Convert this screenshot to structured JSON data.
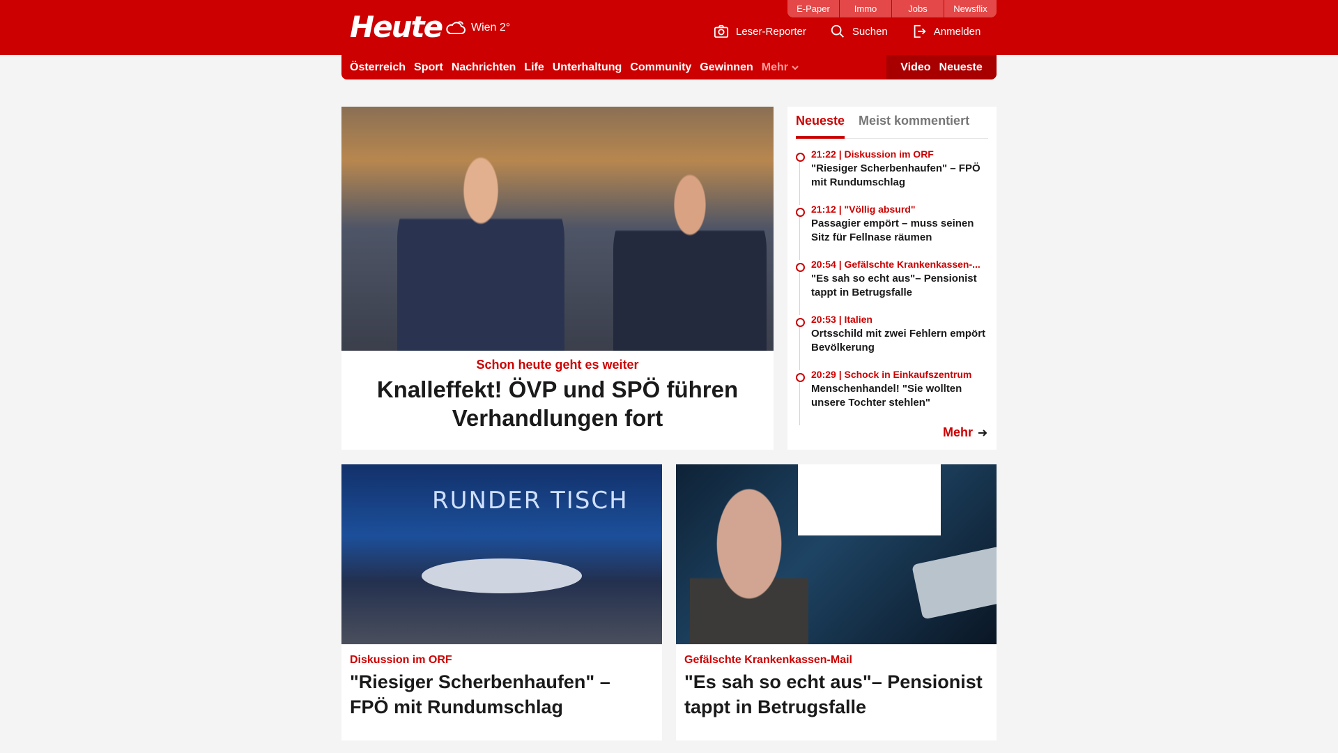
{
  "brand": {
    "logo": "Heute",
    "weather": "Wien 2°"
  },
  "quicklinks": [
    "E-Paper",
    "Immo",
    "Jobs",
    "Newsflix"
  ],
  "actions": {
    "reporter": "Leser-Reporter",
    "search": "Suchen",
    "login": "Anmelden"
  },
  "nav": {
    "items": [
      "Österreich",
      "Sport",
      "Nachrichten",
      "Life",
      "Unterhaltung",
      "Community",
      "Gewinnen"
    ],
    "more": "Mehr",
    "video": "Video",
    "latest": "Neueste"
  },
  "hero": {
    "kicker": "Schon heute geht es weiter",
    "title": "Knalleffekt! ÖVP und SPÖ führen Verhandlungen fort"
  },
  "sidebar": {
    "tabs": [
      "Neueste",
      "Meist kommentiert"
    ],
    "items": [
      {
        "meta": "21:22 | Diskussion im ORF",
        "title": "\"Riesiger Scherbenhaufen\" – FPÖ mit Rundumschlag"
      },
      {
        "meta": "21:12 | \"Völlig absurd\"",
        "title": "Passagier empört – muss seinen Sitz für Fellnase räumen"
      },
      {
        "meta": "20:54 | Gefälschte Krankenkassen-...",
        "title": "\"Es sah so echt aus\"– Pensionist tappt in Betrugsfalle"
      },
      {
        "meta": "20:53 | Italien",
        "title": "Ortsschild mit zwei Fehlern empört Bevölkerung"
      },
      {
        "meta": "20:29 | Schock in Einkaufszentrum",
        "title": "Menschenhandel! \"Sie wollten unsere Tochter stehlen\""
      }
    ],
    "more": "Mehr"
  },
  "cards": [
    {
      "kicker": "Diskussion im ORF",
      "title": "\"Riesiger Scherbenhaufen\" – FPÖ mit Rundumschlag",
      "image_text": "RUNDER TISCH"
    },
    {
      "kicker": "Gefälschte Krankenkassen-Mail",
      "title": "\"Es sah so echt aus\"– Pensionist tappt in Betrugsfalle"
    }
  ]
}
